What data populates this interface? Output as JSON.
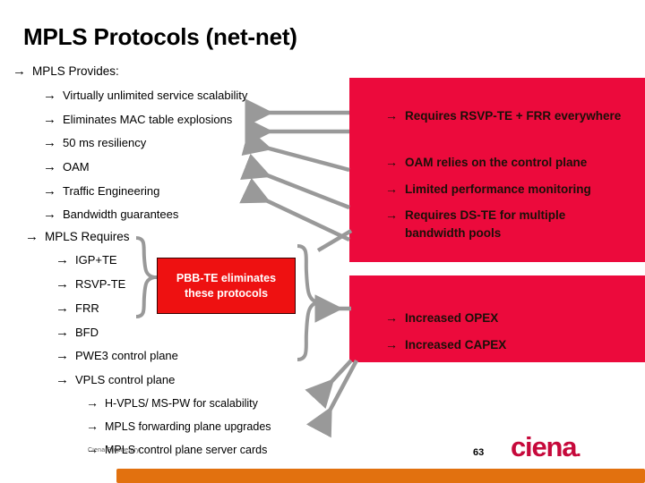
{
  "slide": {
    "title": "MPLS Protocols (net-net)",
    "arrow_glyph": "→"
  },
  "left_column": {
    "provides_heading": "MPLS Provides:",
    "provides_items": [
      "Virtually unlimited  service scalability",
      "Eliminates MAC table explosions",
      "50 ms resiliency",
      "OAM",
      "Traffic Engineering",
      "Bandwidth guarantees"
    ],
    "requires_heading": "MPLS Requires",
    "requires_items": [
      "IGP+TE",
      "RSVP-TE",
      "FRR",
      "BFD",
      "PWE3 control plane",
      "VPLS control plane"
    ],
    "requires_subitems": [
      "H-VPLS/ MS-PW for scalability",
      "MPLS forwarding plane upgrades",
      "MPLS control plane server cards"
    ]
  },
  "callout": {
    "line1": "PBB-TE eliminates",
    "line2": "these protocols",
    "box_color": "#EE1111",
    "text_color": "#FFFFFF"
  },
  "red_panel_top": {
    "background": "#EC0A3C",
    "items": [
      "Requires RSVP-TE + FRR everywhere",
      "OAM relies on the control plane",
      "Limited performance monitoring",
      "Requires DS-TE for multiple bandwidth pools"
    ]
  },
  "red_panel_bottom": {
    "background": "#EC0A3C",
    "items": [
      "Increased OPEX",
      "Increased CAPEX"
    ]
  },
  "footer": {
    "page_number": "63",
    "logo_text": "ciena",
    "logo_dot": ".",
    "logo_color": "#C6093B",
    "proprietary_text": "Ciena Proprietary",
    "bar_color": "#E2710F"
  },
  "connectors": {
    "arrow_color": "#999999",
    "brace_color": "#999999"
  }
}
